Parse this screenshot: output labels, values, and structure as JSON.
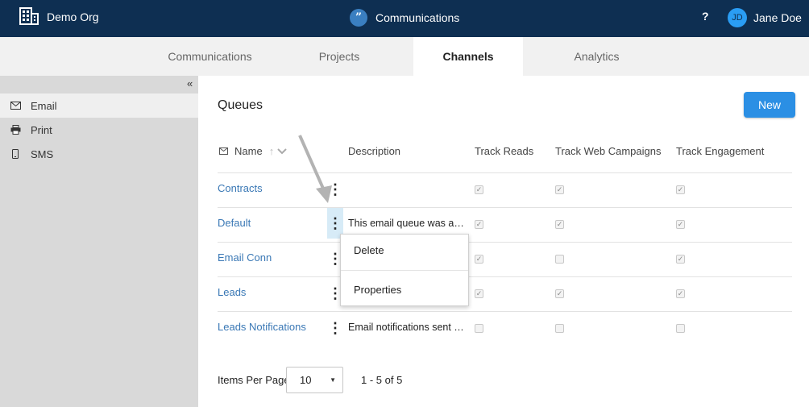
{
  "header": {
    "org_name": "Demo Org",
    "app_name": "Communications",
    "app_glyph": "”",
    "help_label": "?",
    "user_initials": "JD",
    "user_name": "Jane Doe"
  },
  "tabs": [
    {
      "label": "Communications",
      "active": false
    },
    {
      "label": "Projects",
      "active": false
    },
    {
      "label": "Channels",
      "active": true
    },
    {
      "label": "Analytics",
      "active": false
    }
  ],
  "sidebar": {
    "collapse_glyph": "«",
    "items": [
      {
        "label": "Email",
        "icon": "envelope-icon",
        "active": true
      },
      {
        "label": "Print",
        "icon": "printer-icon",
        "active": false
      },
      {
        "label": "SMS",
        "icon": "mobile-icon",
        "active": false
      }
    ]
  },
  "main": {
    "title": "Queues",
    "new_button": "New",
    "columns": {
      "name": "Name",
      "description": "Description",
      "track_reads": "Track Reads",
      "track_web": "Track Web Campaigns",
      "track_engagement": "Track Engagement"
    },
    "rows": [
      {
        "name": "Contracts",
        "description": "",
        "track_reads": true,
        "track_web": true,
        "track_engagement": true
      },
      {
        "name": "Default",
        "description": "This email queue was au…",
        "track_reads": true,
        "track_web": true,
        "track_engagement": true
      },
      {
        "name": "Email Conn",
        "description": "",
        "track_reads": true,
        "track_web": false,
        "track_engagement": true
      },
      {
        "name": "Leads",
        "description": "",
        "track_reads": true,
        "track_web": true,
        "track_engagement": true
      },
      {
        "name": "Leads Notifications",
        "description": "Email notifications sent …",
        "track_reads": false,
        "track_web": false,
        "track_engagement": false
      }
    ],
    "context_menu": {
      "items": [
        "Delete",
        "Properties"
      ]
    },
    "pagination": {
      "items_per_page_label": "Items Per Page",
      "items_per_page_value": "10",
      "range_text": "1 - 5 of 5"
    }
  },
  "colors": {
    "header_bg": "#0e2f52",
    "accent": "#2b8fe4",
    "link": "#3a78b5"
  }
}
